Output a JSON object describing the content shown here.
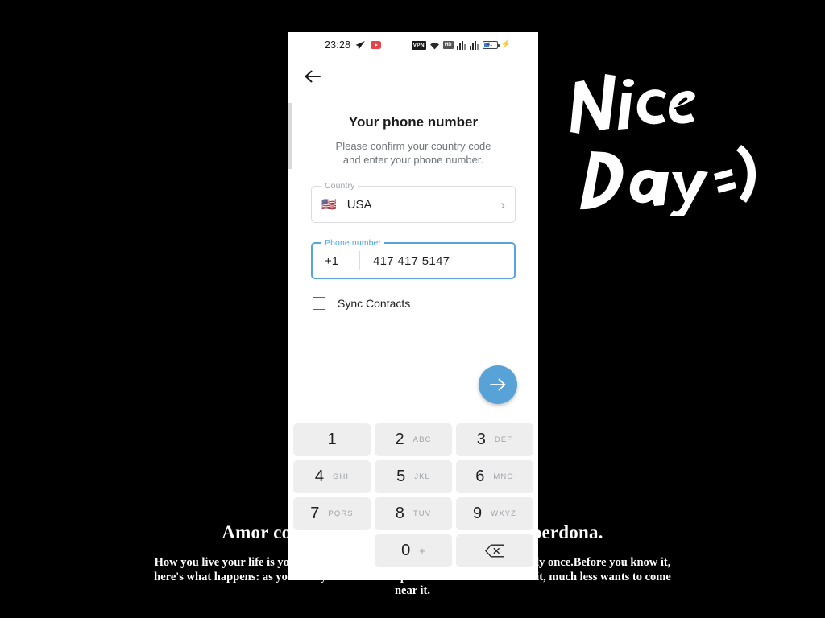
{
  "status_bar": {
    "time": "23:28",
    "telegram_icon": "send-icon",
    "youtube_icon": "youtube-icon",
    "vpn_label": "VPN",
    "wifi_icon": "wifi-icon",
    "hd_label": "HD",
    "signal_1_icon": "signal-bars-icon",
    "signal_2_icon": "signal-bars-icon",
    "battery_percent": "41",
    "battery_charging_icon": "bolt-icon"
  },
  "nav": {
    "back_icon": "back-arrow-icon"
  },
  "screen": {
    "title": "Your phone number",
    "subtitle": "Please confirm your country code\nand enter your phone number."
  },
  "country_field": {
    "label": "Country",
    "flag": "🇺🇸",
    "value": "USA",
    "chevron_icon": "chevron-right-icon"
  },
  "phone_field": {
    "label": "Phone number",
    "dial_code": "+1",
    "value": "417 417 5147",
    "focused": true,
    "focus_color": "#56a5dd"
  },
  "sync": {
    "label": "Sync Contacts",
    "checked": false
  },
  "fab": {
    "icon": "arrow-right-icon",
    "color": "#57a3d8"
  },
  "keypad": {
    "rows": [
      [
        {
          "digit": "1",
          "letters": ""
        },
        {
          "digit": "2",
          "letters": "ABC"
        },
        {
          "digit": "3",
          "letters": "DEF"
        }
      ],
      [
        {
          "digit": "4",
          "letters": "GHI"
        },
        {
          "digit": "5",
          "letters": "JKL"
        },
        {
          "digit": "6",
          "letters": "MNO"
        }
      ],
      [
        {
          "digit": "7",
          "letters": "PQRS"
        },
        {
          "digit": "8",
          "letters": "TUV"
        },
        {
          "digit": "9",
          "letters": "WXYZ"
        }
      ],
      [
        {
          "digit": "",
          "letters": "",
          "blank": true
        },
        {
          "digit": "0",
          "letters": "+"
        },
        {
          "digit": "",
          "letters": "",
          "backspace": true
        }
      ]
    ]
  },
  "overlay": {
    "handwriting_line1": "Nice",
    "handwriting_line2": "Day =)",
    "caption_headline": "Amor con amor se paga, amar o amar perdona.",
    "caption_body": "How you live your life is your own business and our bodies are given to us only once.Before you know it, here's what happens: as your body there comes a point when no one looks at it,  much less wants to come near it."
  }
}
